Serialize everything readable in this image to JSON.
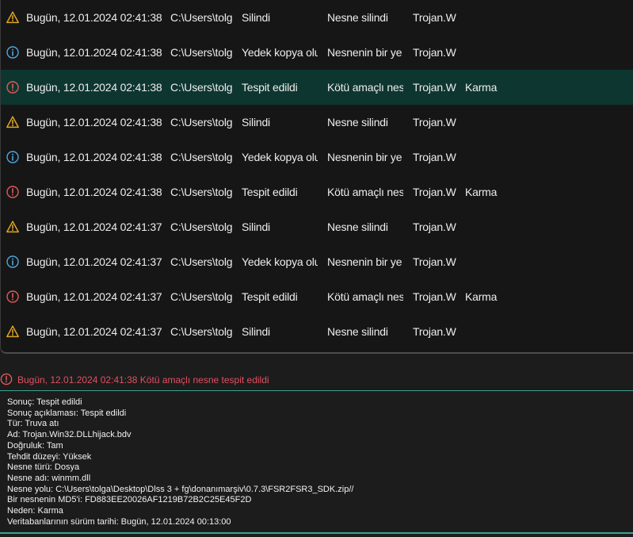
{
  "colors": {
    "warning": "#e0a623",
    "info": "#4fa6dd",
    "danger": "#e05a5a",
    "selected_row": "#0e3630",
    "accent": "#3fa28f"
  },
  "events": [
    {
      "icon": "warning-icon",
      "time": "Bugün, 12.01.2024 02:41:38",
      "path": "C:\\Users\\tolg",
      "result": "Silindi",
      "description": "Nesne silindi",
      "type": "Trojan.W",
      "reason": ""
    },
    {
      "icon": "info-icon",
      "time": "Bugün, 12.01.2024 02:41:38",
      "path": "C:\\Users\\tolg",
      "result": "Yedek kopya olu",
      "description": "Nesnenin bir ye",
      "type": "Trojan.W",
      "reason": ""
    },
    {
      "icon": "danger-icon",
      "time": "Bugün, 12.01.2024 02:41:38",
      "path": "C:\\Users\\tolg",
      "result": "Tespit edildi",
      "description": "Kötü amaçlı nes",
      "type": "Trojan.W",
      "reason": "Karma",
      "selected": true
    },
    {
      "icon": "warning-icon",
      "time": "Bugün, 12.01.2024 02:41:38",
      "path": "C:\\Users\\tolg",
      "result": "Silindi",
      "description": "Nesne silindi",
      "type": "Trojan.W",
      "reason": ""
    },
    {
      "icon": "info-icon",
      "time": "Bugün, 12.01.2024 02:41:38",
      "path": "C:\\Users\\tolg",
      "result": "Yedek kopya olu",
      "description": "Nesnenin bir ye",
      "type": "Trojan.W",
      "reason": ""
    },
    {
      "icon": "danger-icon",
      "time": "Bugün, 12.01.2024 02:41:38",
      "path": "C:\\Users\\tolg",
      "result": "Tespit edildi",
      "description": "Kötü amaçlı nes",
      "type": "Trojan.W",
      "reason": "Karma"
    },
    {
      "icon": "warning-icon",
      "time": "Bugün, 12.01.2024 02:41:37",
      "path": "C:\\Users\\tolg",
      "result": "Silindi",
      "description": "Nesne silindi",
      "type": "Trojan.W",
      "reason": ""
    },
    {
      "icon": "info-icon",
      "time": "Bugün, 12.01.2024 02:41:37",
      "path": "C:\\Users\\tolg",
      "result": "Yedek kopya olu",
      "description": "Nesnenin bir ye",
      "type": "Trojan.W",
      "reason": ""
    },
    {
      "icon": "danger-icon",
      "time": "Bugün, 12.01.2024 02:41:37",
      "path": "C:\\Users\\tolg",
      "result": "Tespit edildi",
      "description": "Kötü amaçlı nes",
      "type": "Trojan.W",
      "reason": "Karma"
    },
    {
      "icon": "warning-icon",
      "time": "Bugün, 12.01.2024 02:41:37",
      "path": "C:\\Users\\tolg",
      "result": "Silindi",
      "description": "Nesne silindi",
      "type": "Trojan.W",
      "reason": ""
    }
  ],
  "details": {
    "title_icon": "danger-icon",
    "title": "Bugün, 12.01.2024 02:41:38 Kötü amaçlı nesne tespit edildi",
    "lines": [
      "Sonuç: Tespit edildi",
      "Sonuç açıklaması: Tespit edildi",
      "Tür: Truva atı",
      "Ad: Trojan.Win32.DLLhijack.bdv",
      "Doğruluk: Tam",
      "Tehdit düzeyi: Yüksek",
      "Nesne türü: Dosya",
      "Nesne adı: winmm.dll",
      "Nesne yolu: C:\\Users\\tolga\\Desktop\\Dlss 3 + fg\\donanımarşiv\\0.7.3\\FSR2FSR3_SDK.zip//",
      "Bir nesnenin MD5'i: FD883EE20026AF1219B72B2C25E45F2D",
      "Neden: Karma",
      "Veritabanlarının sürüm tarihi: Bugün, 12.01.2024 00:13:00"
    ]
  }
}
